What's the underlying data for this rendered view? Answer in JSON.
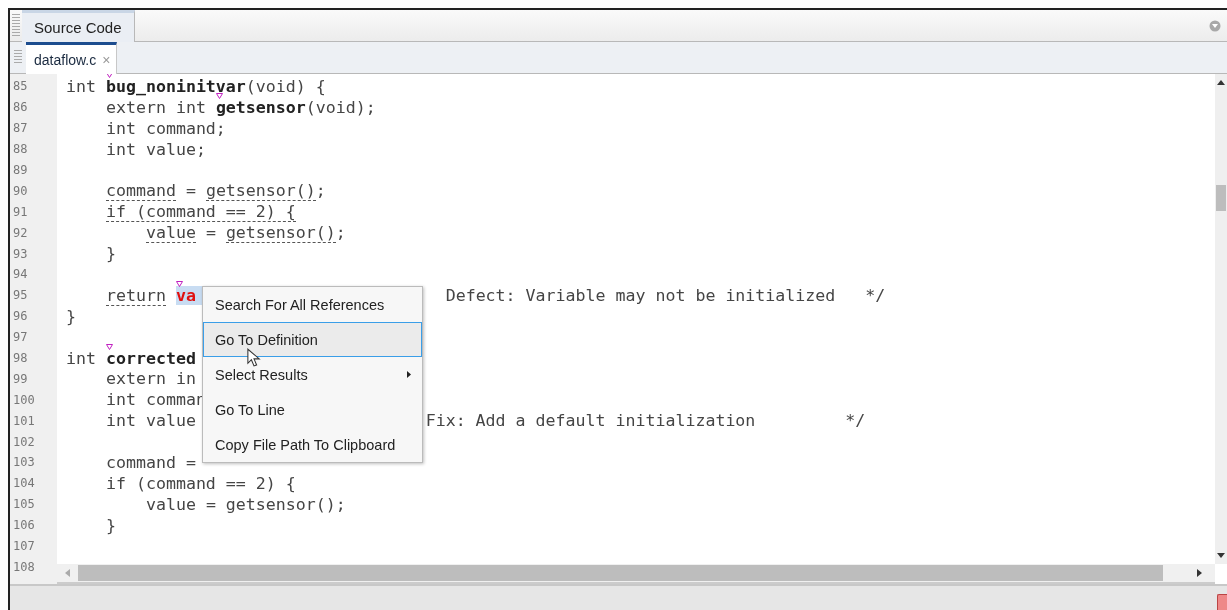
{
  "panel": {
    "title": "Source Code"
  },
  "file_tabs": [
    {
      "label": "dataflow.c",
      "close": "×",
      "selected": true
    }
  ],
  "code_lines": [
    {
      "number": "85",
      "segments": [
        {
          "text": "int "
        },
        {
          "text": "bug_noninitvar",
          "kind": "bold",
          "marker": true
        },
        {
          "text": "(void) {"
        }
      ]
    },
    {
      "number": "86",
      "segments": [
        {
          "text": "    extern int "
        },
        {
          "text": "getsensor",
          "kind": "bold",
          "marker": true
        },
        {
          "text": "(void);"
        }
      ]
    },
    {
      "number": "87",
      "segments": [
        {
          "text": "    int command;"
        }
      ]
    },
    {
      "number": "88",
      "segments": [
        {
          "text": "    int value;"
        }
      ]
    },
    {
      "number": "89"
    },
    {
      "number": "90",
      "segments": [
        {
          "text": "    command",
          "kind": "dashed"
        },
        {
          "text": " = "
        },
        {
          "text": "getsensor()",
          "kind": "dashed"
        },
        {
          "text": ";"
        }
      ]
    },
    {
      "number": "91",
      "segments": [
        {
          "text": "    if (command == 2) {",
          "kind": "dashed"
        }
      ]
    },
    {
      "number": "92",
      "segments": [
        {
          "text": "        value",
          "kind": "dashed"
        },
        {
          "text": " = "
        },
        {
          "text": "getsensor()",
          "kind": "dashed"
        },
        {
          "text": ";"
        }
      ]
    },
    {
      "number": "93",
      "segments": [
        {
          "text": "    }"
        }
      ]
    },
    {
      "number": "94"
    },
    {
      "number": "95",
      "segments": [
        {
          "text": "    return",
          "kind": "dashed"
        },
        {
          "text": " va",
          "kind": "error",
          "marker": true
        },
        {
          "text": "                       Defect: Variable may not be initialized   */"
        }
      ]
    },
    {
      "number": "96",
      "segments": [
        {
          "text": "}"
        }
      ]
    },
    {
      "number": "97"
    },
    {
      "number": "98",
      "segments": [
        {
          "text": "int "
        },
        {
          "text": "corrected",
          "kind": "bold",
          "marker": true
        }
      ]
    },
    {
      "number": "99",
      "segments": [
        {
          "text": "    extern in"
        }
      ]
    },
    {
      "number": "100",
      "segments": [
        {
          "text": "    int comman"
        }
      ]
    },
    {
      "number": "101",
      "segments": [
        {
          "text": "    int value"
        },
        {
          "text": "                       Fix: Add a default initialization         */"
        }
      ]
    },
    {
      "number": "102"
    },
    {
      "number": "103",
      "segments": [
        {
          "text": "    command ="
        }
      ]
    },
    {
      "number": "104",
      "segments": [
        {
          "text": "    if (command == 2) {"
        }
      ]
    },
    {
      "number": "105",
      "segments": [
        {
          "text": "        value = getsensor();"
        }
      ]
    },
    {
      "number": "106",
      "segments": [
        {
          "text": "    }"
        }
      ]
    },
    {
      "number": "107"
    },
    {
      "number": "108"
    }
  ],
  "context_menu": [
    {
      "label": "Search For All References",
      "submenu": false,
      "selected": false
    },
    {
      "label": "Go To Definition",
      "submenu": false,
      "selected": true
    },
    {
      "label": "Select Results",
      "submenu": true,
      "selected": false
    },
    {
      "label": "Go To Line",
      "submenu": false,
      "selected": false
    },
    {
      "label": "Copy File Path To Clipboard",
      "submenu": false,
      "selected": false
    }
  ]
}
